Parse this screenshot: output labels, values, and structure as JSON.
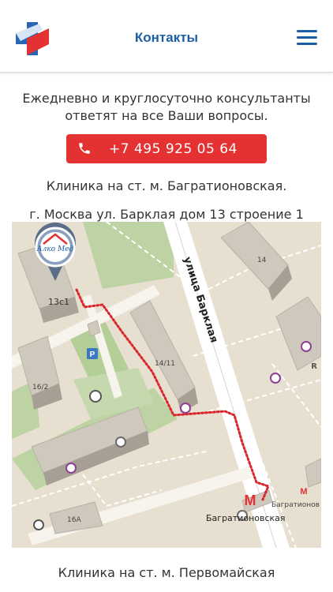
{
  "header": {
    "title": "Контакты",
    "logo_icon": "cross-logo-icon",
    "menu_icon": "hamburger-menu-icon"
  },
  "intro": {
    "line1": "Ежедневно и круглосуточно консультанты",
    "line2": "ответят на все Ваши вопросы."
  },
  "phone_button": {
    "icon": "phone-icon",
    "number": "+7 495 925 05 64",
    "color": "#e43233"
  },
  "clinics": [
    {
      "title": "Клиника на ст. м. Багратионовская.",
      "address": "г. Москва ул. Барклая дом 13 строение 1",
      "map": {
        "street_label": "улица Барклая",
        "marker_text": "Алко Мед",
        "buildings": [
          "13с1",
          "14",
          "14/11",
          "16/2",
          "16А"
        ],
        "metro_station": "Багратионовская",
        "metro_station_cut": "Багратионов",
        "edge_letter": "R",
        "parking_label": "P"
      }
    },
    {
      "title": "Клиника на ст. м. Первомайская"
    }
  ],
  "colors": {
    "brand_blue": "#1c5fa8",
    "route": "#d9262c",
    "map_bg": "#e7dfcf"
  }
}
